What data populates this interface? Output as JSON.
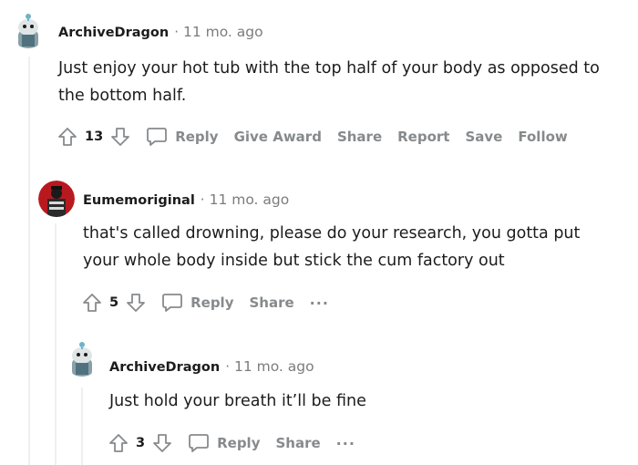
{
  "comments": [
    {
      "author": "ArchiveDragon",
      "separator": "·",
      "time": "11 mo. ago",
      "lines": [
        "Just enjoy your hot tub with the top half of your body as opposed to",
        "the bottom half."
      ],
      "score": "13",
      "actions": [
        "Reply",
        "Give Award",
        "Share",
        "Report",
        "Save",
        "Follow"
      ]
    },
    {
      "author": "Eumemoriginal",
      "separator": "·",
      "time": "11 mo. ago",
      "lines": [
        "that's called drowning, please do your research, you gotta put",
        "your whole body inside but stick the cum factory out"
      ],
      "score": "5",
      "actions": [
        "Reply",
        "Share"
      ],
      "more": "···"
    },
    {
      "author": "ArchiveDragon",
      "separator": "·",
      "time": "11 mo. ago",
      "lines": [
        "Just hold your breath it’ll be fine"
      ],
      "score": "3",
      "actions": [
        "Reply",
        "Share"
      ],
      "more": "···"
    }
  ],
  "icons": {
    "upvote": "upvote-arrow-icon",
    "downvote": "downvote-arrow-icon",
    "reply": "speech-bubble-icon",
    "avatar_snoo": "snoo-avatar-icon",
    "avatar_dark": "dark-figure-avatar-icon"
  },
  "colors": {
    "text": "#1c1c1c",
    "meta": "#7c7c7c",
    "action": "#878a8c",
    "thread": "#edeff1"
  }
}
